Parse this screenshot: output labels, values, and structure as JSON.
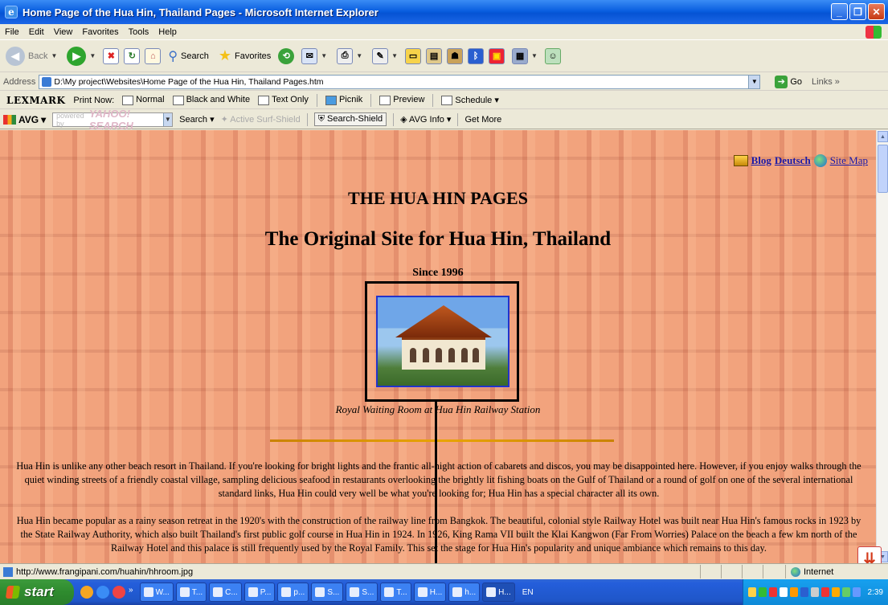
{
  "window": {
    "title": "Home Page of the Hua Hin, Thailand Pages - Microsoft Internet Explorer"
  },
  "menu": [
    "File",
    "Edit",
    "View",
    "Favorites",
    "Tools",
    "Help"
  ],
  "toolbar": {
    "back": "Back",
    "search": "Search",
    "favorites": "Favorites"
  },
  "address": {
    "label": "Address",
    "value": "D:\\My project\\Websites\\Home Page of the Hua Hin, Thailand Pages.htm",
    "go": "Go",
    "links": "Links"
  },
  "lexmark": {
    "brand": "LEXMARK",
    "print_now": "Print Now:",
    "normal": "Normal",
    "bw": "Black and White",
    "text_only": "Text Only",
    "picnik": "Picnik",
    "preview": "Preview",
    "schedule": "Schedule"
  },
  "avg": {
    "brand": "AVG",
    "powered": "powered by",
    "yahoo": "YAHOO! SEARCH",
    "search": "Search",
    "active": "Active",
    "surf_shield": "Surf-Shield",
    "search_shield": "Search-Shield",
    "avg_info": "AVG Info",
    "get_more": "Get More"
  },
  "page": {
    "top_links": {
      "blog": "Blog",
      "deutsch": "Deutsch",
      "sitemap": "Site Map"
    },
    "heading": "THE HUA HIN PAGES",
    "subheading": "The Original Site for Hua Hin, Thailand",
    "since": "Since 1996",
    "caption": "Royal Waiting Room at Hua Hin Railway Station",
    "para1": "Hua Hin is unlike any other beach resort in Thailand. If you're looking for bright lights and the frantic all-night action of cabarets and discos, you may be disappointed here. However, if you enjoy walks through the quiet winding streets of a friendly coastal village, sampling delicious seafood in restaurants overlooking the brightly lit fishing boats on the Gulf of Thailand or a round of golf on one of the several international standard links, Hua Hin could very well be what you're looking for; Hua Hin has a special character all its own.",
    "para2": "Hua Hin became popular as a rainy season retreat in the 1920's with the construction of the railway line from Bangkok. The beautiful, colonial style Railway Hotel was built near Hua Hin's famous rocks in 1923 by the State Railway Authority, which also built Thailand's first public golf course in Hua Hin in 1924. In 1926, King Rama VII built the Klai Kangwon (Far From Worries) Palace on the beach a few km north of the Railway Hotel and this palace is still frequently used by the Royal Family. This set the stage for Hua Hin's popularity and unique ambiance which remains to this day."
  },
  "status": {
    "url": "http://www.frangipani.com/huahin/hhroom.jpg",
    "zone": "Internet"
  },
  "taskbar": {
    "start": "start",
    "tasks": [
      "W...",
      "T...",
      "C...",
      "P...",
      "p...",
      "S...",
      "S...",
      "T...",
      "H...",
      "h...",
      "H..."
    ],
    "lang": "EN",
    "clock": "2:39"
  }
}
